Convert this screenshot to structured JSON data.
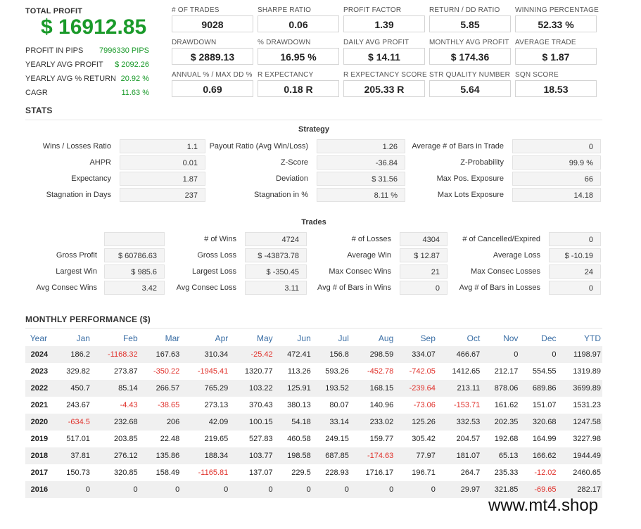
{
  "summary": {
    "total_profit_label": "TOTAL PROFIT",
    "total_profit_value": "$ 16912.85",
    "rows": [
      {
        "label": "PROFIT IN PIPS",
        "value": "7996330 PIPS"
      },
      {
        "label": "YEARLY AVG PROFIT",
        "value": "$ 2092.26"
      },
      {
        "label": "YEARLY AVG % RETURN",
        "value": "20.92 %"
      },
      {
        "label": "CAGR",
        "value": "11.63 %"
      }
    ]
  },
  "metrics": [
    {
      "label": "# OF TRADES",
      "value": "9028"
    },
    {
      "label": "SHARPE RATIO",
      "value": "0.06"
    },
    {
      "label": "PROFIT FACTOR",
      "value": "1.39"
    },
    {
      "label": "RETURN / DD RATIO",
      "value": "5.85"
    },
    {
      "label": "WINNING PERCENTAGE",
      "value": "52.33 %"
    },
    {
      "label": "DRAWDOWN",
      "value": "$ 2889.13"
    },
    {
      "label": "% DRAWDOWN",
      "value": "16.95 %"
    },
    {
      "label": "DAILY AVG PROFIT",
      "value": "$ 14.11"
    },
    {
      "label": "MONTHLY AVG PROFIT",
      "value": "$ 174.36"
    },
    {
      "label": "AVERAGE TRADE",
      "value": "$ 1.87"
    },
    {
      "label": "ANNUAL % / MAX DD %",
      "value": "0.69"
    },
    {
      "label": "R EXPECTANCY",
      "value": "0.18 R"
    },
    {
      "label": "R EXPECTANCY SCORE",
      "value": "205.33 R"
    },
    {
      "label": "STR QUALITY NUMBER",
      "value": "5.64"
    },
    {
      "label": "SQN SCORE",
      "value": "18.53"
    }
  ],
  "stats_title": "STATS",
  "strategy": {
    "title": "Strategy",
    "rows": [
      [
        {
          "label": "Wins / Losses Ratio",
          "value": "1.1"
        },
        {
          "label": "Payout Ratio (Avg Win/Loss)",
          "value": "1.26"
        },
        {
          "label": "Average # of Bars in Trade",
          "value": "0"
        }
      ],
      [
        {
          "label": "AHPR",
          "value": "0.01"
        },
        {
          "label": "Z-Score",
          "value": "-36.84"
        },
        {
          "label": "Z-Probability",
          "value": "99.9 %"
        }
      ],
      [
        {
          "label": "Expectancy",
          "value": "1.87"
        },
        {
          "label": "Deviation",
          "value": "$ 31.56"
        },
        {
          "label": "Max Pos. Exposure",
          "value": "66"
        }
      ],
      [
        {
          "label": "Stagnation in Days",
          "value": "237"
        },
        {
          "label": "Stagnation in %",
          "value": "8.11 %"
        },
        {
          "label": "Max Lots Exposure",
          "value": "14.18"
        }
      ]
    ]
  },
  "trades": {
    "title": "Trades",
    "rows": [
      [
        {
          "label": "",
          "value": ""
        },
        {
          "label": "# of Wins",
          "value": "4724"
        },
        {
          "label": "# of Losses",
          "value": "4304"
        },
        {
          "label": "# of Cancelled/Expired",
          "value": "0"
        }
      ],
      [
        {
          "label": "Gross Profit",
          "value": "$ 60786.63"
        },
        {
          "label": "Gross Loss",
          "value": "$ -43873.78"
        },
        {
          "label": "Average Win",
          "value": "$ 12.87"
        },
        {
          "label": "Average Loss",
          "value": "$ -10.19"
        }
      ],
      [
        {
          "label": "Largest Win",
          "value": "$ 985.6"
        },
        {
          "label": "Largest Loss",
          "value": "$ -350.45"
        },
        {
          "label": "Max Consec Wins",
          "value": "21"
        },
        {
          "label": "Max Consec Losses",
          "value": "24"
        }
      ],
      [
        {
          "label": "Avg Consec Wins",
          "value": "3.42"
        },
        {
          "label": "Avg Consec Loss",
          "value": "3.11"
        },
        {
          "label": "Avg # of Bars in Wins",
          "value": "0"
        },
        {
          "label": "Avg # of Bars in Losses",
          "value": "0"
        }
      ]
    ]
  },
  "monthly": {
    "title": "MONTHLY PERFORMANCE ($)",
    "headers": [
      "Year",
      "Jan",
      "Feb",
      "Mar",
      "Apr",
      "May",
      "Jun",
      "Jul",
      "Aug",
      "Sep",
      "Oct",
      "Nov",
      "Dec",
      "YTD"
    ],
    "rows": [
      [
        "2024",
        "186.2",
        "-1168.32",
        "167.63",
        "310.34",
        "-25.42",
        "472.41",
        "156.8",
        "298.59",
        "334.07",
        "466.67",
        "0",
        "0",
        "1198.97"
      ],
      [
        "2023",
        "329.82",
        "273.87",
        "-350.22",
        "-1945.41",
        "1320.77",
        "113.26",
        "593.26",
        "-452.78",
        "-742.05",
        "1412.65",
        "212.17",
        "554.55",
        "1319.89"
      ],
      [
        "2022",
        "450.7",
        "85.14",
        "266.57",
        "765.29",
        "103.22",
        "125.91",
        "193.52",
        "168.15",
        "-239.64",
        "213.11",
        "878.06",
        "689.86",
        "3699.89"
      ],
      [
        "2021",
        "243.67",
        "-4.43",
        "-38.65",
        "273.13",
        "370.43",
        "380.13",
        "80.07",
        "140.96",
        "-73.06",
        "-153.71",
        "161.62",
        "151.07",
        "1531.23"
      ],
      [
        "2020",
        "-634.5",
        "232.68",
        "206",
        "42.09",
        "100.15",
        "54.18",
        "33.14",
        "233.02",
        "125.26",
        "332.53",
        "202.35",
        "320.68",
        "1247.58"
      ],
      [
        "2019",
        "517.01",
        "203.85",
        "22.48",
        "219.65",
        "527.83",
        "460.58",
        "249.15",
        "159.77",
        "305.42",
        "204.57",
        "192.68",
        "164.99",
        "3227.98"
      ],
      [
        "2018",
        "37.81",
        "276.12",
        "135.86",
        "188.34",
        "103.77",
        "198.58",
        "687.85",
        "-174.63",
        "77.97",
        "181.07",
        "65.13",
        "166.62",
        "1944.49"
      ],
      [
        "2017",
        "150.73",
        "320.85",
        "158.49",
        "-1165.81",
        "137.07",
        "229.5",
        "228.93",
        "1716.17",
        "196.71",
        "264.7",
        "235.33",
        "-12.02",
        "2460.65"
      ],
      [
        "2016",
        "0",
        "0",
        "0",
        "0",
        "0",
        "0",
        "0",
        "0",
        "0",
        "29.97",
        "321.85",
        "-69.65",
        "282.17"
      ]
    ]
  },
  "watermark": "www.mt4.shop",
  "colors": {
    "profit_green": "#1a9a2a",
    "negative_red": "#e0302a",
    "header_blue": "#3a6ea5"
  }
}
